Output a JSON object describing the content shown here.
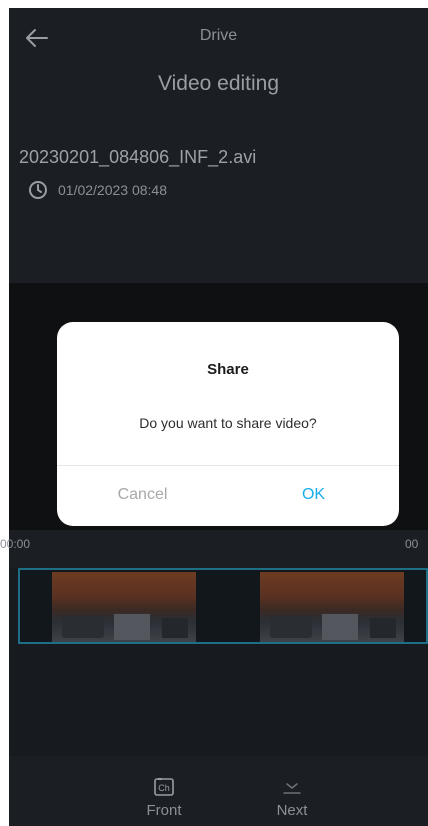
{
  "header": {
    "title": "Drive"
  },
  "info": {
    "section_title": "Video editing",
    "filename": "20230201_084806_INF_2.avi",
    "datetime": "01/02/2023 08:48"
  },
  "timeline": {
    "start_time": "00:00",
    "end_time": "00"
  },
  "bottom_nav": {
    "front_label": "Front",
    "front_icon_text": "Ch",
    "next_label": "Next"
  },
  "dialog": {
    "title": "Share",
    "message": "Do you want to share video?",
    "cancel_label": "Cancel",
    "ok_label": "OK"
  },
  "colors": {
    "background": "#171a1e",
    "panel": "#1b1f24",
    "accent": "#1aaee8",
    "strip_border": "#1d6f86"
  },
  "icons": [
    "back-arrow-icon",
    "clock-icon",
    "camera-icon",
    "checkmark-icon"
  ]
}
